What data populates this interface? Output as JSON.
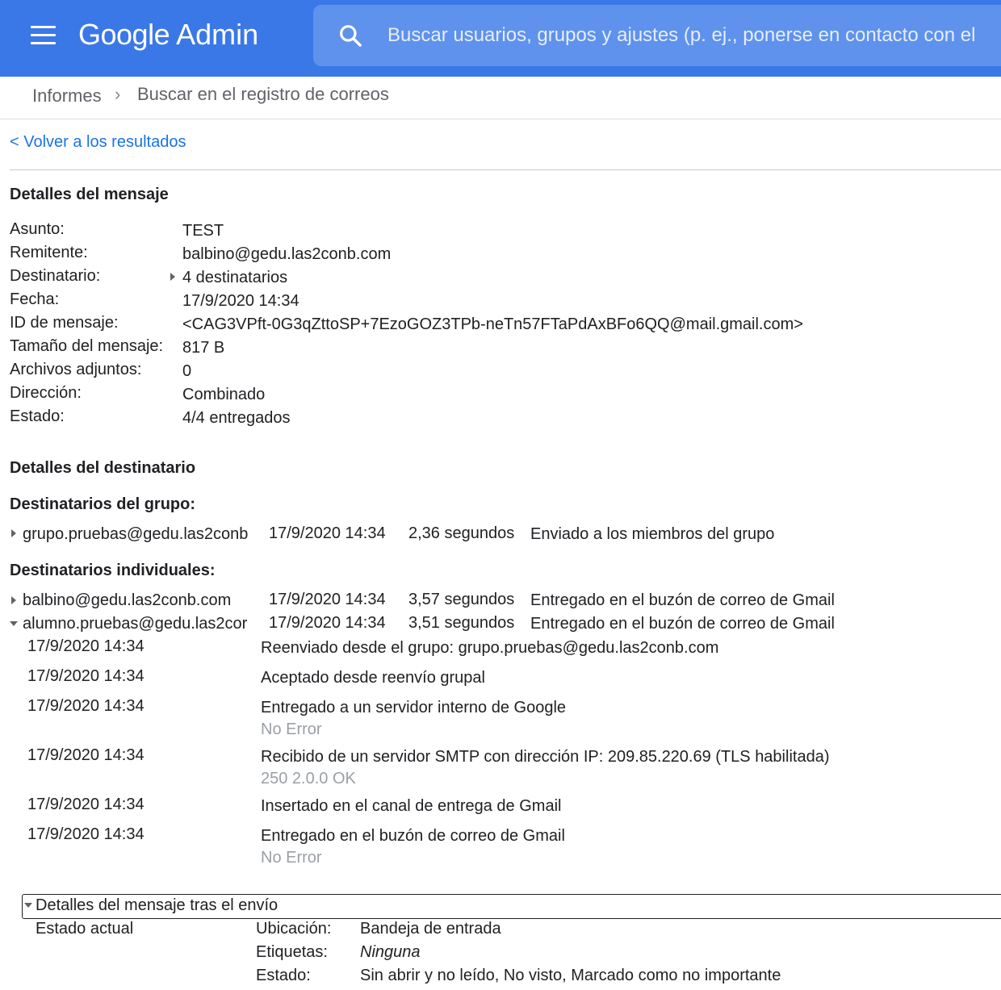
{
  "header": {
    "logo_google": "Google",
    "logo_admin": "Admin",
    "search_placeholder": "Buscar usuarios, grupos y ajustes (p. ej., ponerse en contacto con el"
  },
  "breadcrumb": {
    "root": "Informes",
    "separator": "›",
    "current": "Buscar en el registro de correos"
  },
  "back_link": "< Volver a los resultados",
  "message_details": {
    "title": "Detalles del mensaje",
    "rows": [
      {
        "label": "Asunto:",
        "value": "TEST"
      },
      {
        "label": "Remitente:",
        "value": "balbino@gedu.las2conb.com"
      },
      {
        "label": "Destinatario:",
        "value": "4 destinatarios"
      },
      {
        "label": "Fecha:",
        "value": "17/9/2020 14:34"
      },
      {
        "label": "ID de mensaje:",
        "value": "<CAG3VPft-0G3qZttoSP+7EzoGOZ3TPb-neTn57FTaPdAxBFo6QQ@mail.gmail.com>"
      },
      {
        "label": "Tamaño del mensaje:",
        "value": "817 B"
      },
      {
        "label": "Archivos adjuntos:",
        "value": "0"
      },
      {
        "label": "Dirección:",
        "value": "Combinado"
      },
      {
        "label": "Estado:",
        "value": "4/4 entregados"
      }
    ]
  },
  "recipient_details": {
    "title": "Detalles del destinatario",
    "group_title": "Destinatarios del grupo:",
    "group": [
      {
        "address": "grupo.pruebas@gedu.las2conb",
        "date": "17/9/2020 14:34",
        "duration": "2,36 segundos",
        "status": "Enviado a los miembros del grupo"
      }
    ],
    "individual_title": "Destinatarios individuales:",
    "individual": [
      {
        "address": "balbino@gedu.las2conb.com",
        "date": "17/9/2020 14:34",
        "duration": "3,57 segundos",
        "status": "Entregado en el buzón de correo de Gmail"
      },
      {
        "address": "alumno.pruebas@gedu.las2cor",
        "date": "17/9/2020 14:34",
        "duration": "3,51 segundos",
        "status": "Entregado en el buzón de correo de Gmail"
      }
    ],
    "events": [
      {
        "date": "17/9/2020 14:34",
        "text": "Reenviado desde el grupo: grupo.pruebas@gedu.las2conb.com",
        "sub": ""
      },
      {
        "date": "17/9/2020 14:34",
        "text": "Aceptado desde reenvío grupal",
        "sub": ""
      },
      {
        "date": "17/9/2020 14:34",
        "text": "Entregado a un servidor interno de Google",
        "sub": "No Error"
      },
      {
        "date": "17/9/2020 14:34",
        "text": "Recibido de un servidor SMTP con dirección IP: 209.85.220.69 (TLS habilitada)",
        "sub": "250 2.0.0 OK"
      },
      {
        "date": "17/9/2020 14:34",
        "text": "Insertado en el canal de entrega de Gmail",
        "sub": ""
      },
      {
        "date": "17/9/2020 14:34",
        "text": "Entregado en el buzón de correo de Gmail",
        "sub": "No Error"
      }
    ]
  },
  "post_delivery": {
    "title": "Detalles del mensaje tras el envío",
    "current_state_label": "Estado actual",
    "rows": [
      {
        "label": "Ubicación:",
        "value": "Bandeja de entrada"
      },
      {
        "label": "Etiquetas:",
        "value": "Ninguna"
      },
      {
        "label": "Estado:",
        "value": "Sin abrir y no leído, No visto, Marcado como no importante"
      }
    ]
  },
  "colors": {
    "header_bg": "#3b78e7",
    "link": "#1a73e8"
  },
  "icons": [
    "menu-icon",
    "search-icon",
    "chevron-right-icon",
    "triangle-right-icon",
    "triangle-down-icon"
  ]
}
